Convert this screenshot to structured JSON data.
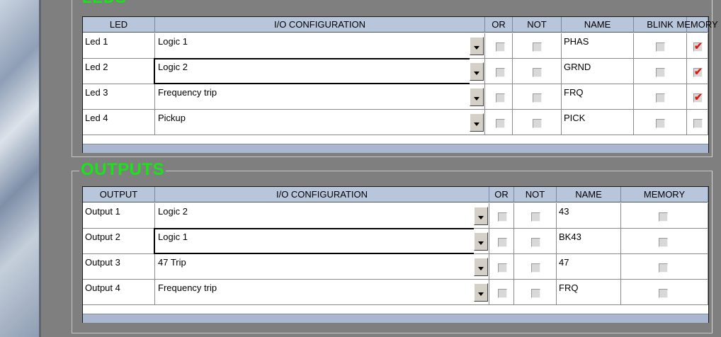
{
  "leds": {
    "title": "LEDS",
    "headers": {
      "led": "LED",
      "io": "I/O CONFIGURATION",
      "or": "OR",
      "not": "NOT",
      "name": "NAME",
      "blink": "BLINK",
      "memory": "MEMORY"
    },
    "rows": [
      {
        "label": "Led 1",
        "io": "Logic 1",
        "or": false,
        "not": false,
        "name": "PHAS",
        "blink": false,
        "memory": true
      },
      {
        "label": "Led 2",
        "io": "Logic 2",
        "or": false,
        "not": false,
        "name": "GRND",
        "blink": false,
        "memory": true
      },
      {
        "label": "Led 3",
        "io": "Frequency trip",
        "or": false,
        "not": false,
        "name": "FRQ",
        "blink": false,
        "memory": true
      },
      {
        "label": "Led 4",
        "io": "Pickup",
        "or": false,
        "not": false,
        "name": "PICK",
        "blink": false,
        "memory": false
      }
    ]
  },
  "outputs": {
    "title": "OUTPUTS",
    "headers": {
      "output": "OUTPUT",
      "io": "I/O CONFIGURATION",
      "or": "OR",
      "not": "NOT",
      "name": "NAME",
      "memory": "MEMORY"
    },
    "rows": [
      {
        "label": "Output 1",
        "io": "Logic 2",
        "or": false,
        "not": false,
        "name": "43",
        "memory": false
      },
      {
        "label": "Output 2",
        "io": "Logic 1",
        "or": false,
        "not": false,
        "name": "BK43",
        "memory": false
      },
      {
        "label": "Output 3",
        "io": "47 Trip",
        "or": false,
        "not": false,
        "name": "47",
        "memory": false
      },
      {
        "label": "Output 4",
        "io": "Frequency trip",
        "or": false,
        "not": false,
        "name": "FRQ",
        "memory": false
      }
    ]
  }
}
